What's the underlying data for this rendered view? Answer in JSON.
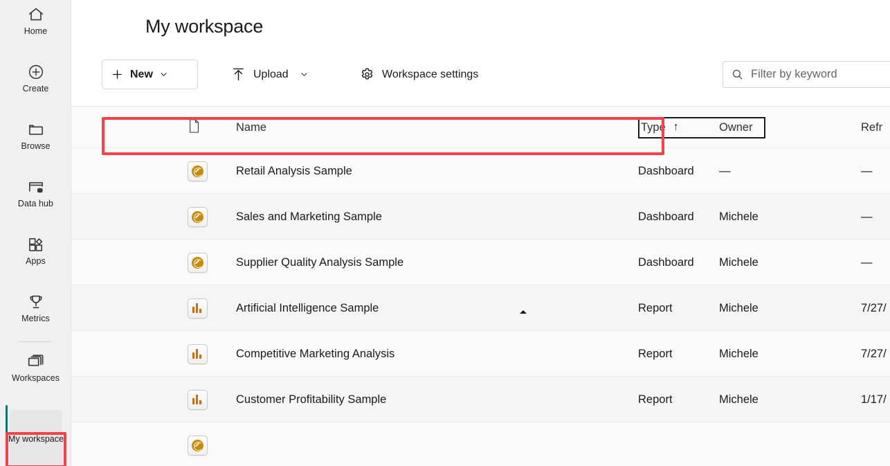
{
  "sidebar": {
    "items": [
      {
        "label": "Home",
        "icon": "home-icon"
      },
      {
        "label": "Create",
        "icon": "plus-circle-icon"
      },
      {
        "label": "Browse",
        "icon": "folder-icon"
      },
      {
        "label": "Data hub",
        "icon": "data-hub-icon"
      },
      {
        "label": "Apps",
        "icon": "apps-icon"
      },
      {
        "label": "Metrics",
        "icon": "trophy-icon"
      },
      {
        "label": "Workspaces",
        "icon": "workspaces-icon"
      }
    ],
    "active_workspace": {
      "label": "My workspace",
      "accent_color": "#16736a"
    }
  },
  "header": {
    "title": "My workspace"
  },
  "toolbar": {
    "new_label": "New",
    "new_icon": "plus-icon",
    "new_chevron": "chevron-down-icon",
    "upload_label": "Upload",
    "upload_icon": "upload-arrow-icon",
    "upload_chevron": "chevron-down-icon",
    "settings_label": "Workspace settings",
    "settings_icon": "gear-icon"
  },
  "search": {
    "placeholder": "Filter by keyword",
    "value": "",
    "icon": "search-icon"
  },
  "table": {
    "columns": {
      "icon": "",
      "icon_glyph": "document-icon",
      "name": "Name",
      "type": "Type",
      "owner": "Owner",
      "refreshed": "Refr"
    },
    "sort": {
      "column": "Type",
      "direction": "ascending",
      "arrow": "↑"
    },
    "rows": [
      {
        "icon": "dashboard-icon",
        "name": "Retail Analysis Sample",
        "type": "Dashboard",
        "owner": "—",
        "refreshed": "—"
      },
      {
        "icon": "dashboard-icon",
        "name": "Sales and Marketing Sample",
        "type": "Dashboard",
        "owner": "Michele",
        "refreshed": "—"
      },
      {
        "icon": "dashboard-icon",
        "name": "Supplier Quality Analysis Sample",
        "type": "Dashboard",
        "owner": "Michele",
        "refreshed": "—"
      },
      {
        "icon": "report-icon",
        "name": "Artificial Intelligence Sample",
        "type": "Report",
        "owner": "Michele",
        "refreshed": "7/27/"
      },
      {
        "icon": "report-icon",
        "name": "Competitive Marketing Analysis",
        "type": "Report",
        "owner": "Michele",
        "refreshed": "7/27/"
      },
      {
        "icon": "report-icon",
        "name": "Customer Profitability Sample",
        "type": "Report",
        "owner": "Michele",
        "refreshed": "1/17/"
      }
    ]
  },
  "annotations": {
    "highlight_color": "#f8414a",
    "highlighted_row": "Sales and Marketing Sample",
    "highlighted_nav": "My workspace"
  }
}
